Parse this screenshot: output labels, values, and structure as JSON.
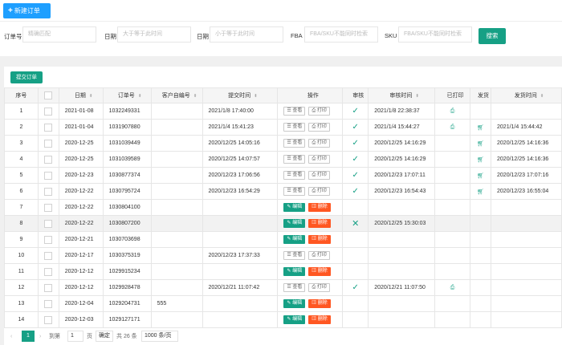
{
  "toolbar": {
    "new_order_label": "新建订单"
  },
  "filters": {
    "order_no_label": "订单号",
    "order_no_placeholder": "精确匹配",
    "date_label_1": "日期",
    "date_from_placeholder": "大于等于此时间",
    "date_label_2": "日期",
    "date_to_placeholder": "小于等于此时间",
    "fba_label": "FBA",
    "fba_placeholder": "FBA/SKU不能同时检索",
    "sku_label": "SKU",
    "sku_placeholder": "FBA/SKU不能同时检索",
    "search_label": "搜索"
  },
  "panel": {
    "submit_label": "提交订单"
  },
  "table": {
    "headers": [
      "序号",
      "",
      "日期",
      "订单号",
      "客户自编号",
      "提交时间",
      "操作",
      "审核",
      "审核时间",
      "已打印",
      "发货",
      "发货时间"
    ],
    "action_labels": {
      "view": "查看",
      "print": "打印",
      "edit": "编辑",
      "delete": "删除"
    },
    "rows": [
      {
        "no": "1",
        "date": "2021-01-08",
        "order": "1032249331",
        "client": "",
        "submit": "2021/1/8 17:40:00",
        "mode": "submitted",
        "audit": "check",
        "audit_time": "2021/1/8 22:38:37",
        "printed": true,
        "shipped": false,
        "ship_time": ""
      },
      {
        "no": "2",
        "date": "2021-01-04",
        "order": "1031907880",
        "client": "",
        "submit": "2021/1/4 15:41:23",
        "mode": "submitted",
        "audit": "check",
        "audit_time": "2021/1/4 15:44:27",
        "printed": true,
        "shipped": true,
        "ship_time": "2021/1/4 15:44:42"
      },
      {
        "no": "3",
        "date": "2020-12-25",
        "order": "1031039449",
        "client": "",
        "submit": "2020/12/25 14:05:16",
        "mode": "submitted",
        "audit": "check",
        "audit_time": "2020/12/25 14:16:29",
        "printed": false,
        "shipped": true,
        "ship_time": "2020/12/25 14:16:36"
      },
      {
        "no": "4",
        "date": "2020-12-25",
        "order": "1031039589",
        "client": "",
        "submit": "2020/12/25 14:07:57",
        "mode": "submitted",
        "audit": "check",
        "audit_time": "2020/12/25 14:16:29",
        "printed": false,
        "shipped": true,
        "ship_time": "2020/12/25 14:16:36"
      },
      {
        "no": "5",
        "date": "2020-12-23",
        "order": "1030877374",
        "client": "",
        "submit": "2020/12/23 17:06:56",
        "mode": "submitted",
        "audit": "check",
        "audit_time": "2020/12/23 17:07:11",
        "printed": false,
        "shipped": true,
        "ship_time": "2020/12/23 17:07:16"
      },
      {
        "no": "6",
        "date": "2020-12-22",
        "order": "1030795724",
        "client": "",
        "submit": "2020/12/23 16:54:29",
        "mode": "submitted",
        "audit": "check",
        "audit_time": "2020/12/23 16:54:43",
        "printed": false,
        "shipped": true,
        "ship_time": "2020/12/23 16:55:04"
      },
      {
        "no": "7",
        "date": "2020-12-22",
        "order": "1030804100",
        "client": "",
        "submit": "",
        "mode": "draft",
        "audit": "",
        "audit_time": "",
        "printed": false,
        "shipped": false,
        "ship_time": ""
      },
      {
        "no": "8",
        "date": "2020-12-22",
        "order": "1030807200",
        "client": "",
        "submit": "",
        "mode": "draft",
        "audit": "cross",
        "audit_time": "2020/12/25 15:30:03",
        "printed": false,
        "shipped": false,
        "ship_time": "",
        "highlight": true
      },
      {
        "no": "9",
        "date": "2020-12-21",
        "order": "1030703698",
        "client": "",
        "submit": "",
        "mode": "draft",
        "audit": "",
        "audit_time": "",
        "printed": false,
        "shipped": false,
        "ship_time": ""
      },
      {
        "no": "10",
        "date": "2020-12-17",
        "order": "1030375319",
        "client": "",
        "submit": "2020/12/23 17:37:33",
        "mode": "submitted",
        "audit": "",
        "audit_time": "",
        "printed": false,
        "shipped": false,
        "ship_time": ""
      },
      {
        "no": "11",
        "date": "2020-12-12",
        "order": "1029915234",
        "client": "",
        "submit": "",
        "mode": "draft",
        "audit": "",
        "audit_time": "",
        "printed": false,
        "shipped": false,
        "ship_time": ""
      },
      {
        "no": "12",
        "date": "2020-12-12",
        "order": "1029928478",
        "client": "",
        "submit": "2020/12/21 11:07:42",
        "mode": "submitted",
        "audit": "check",
        "audit_time": "2020/12/21 11:07:50",
        "printed": true,
        "shipped": false,
        "ship_time": ""
      },
      {
        "no": "13",
        "date": "2020-12-04",
        "order": "1029204731",
        "client": "555",
        "submit": "",
        "mode": "draft",
        "audit": "",
        "audit_time": "",
        "printed": false,
        "shipped": false,
        "ship_time": ""
      },
      {
        "no": "14",
        "date": "2020-12-03",
        "order": "1029127171",
        "client": "",
        "submit": "",
        "mode": "draft",
        "audit": "",
        "audit_time": "",
        "printed": false,
        "shipped": false,
        "ship_time": ""
      }
    ]
  },
  "pager": {
    "current_page": "1",
    "goto_label": "到第",
    "goto_value": "1",
    "page_unit": "页",
    "confirm_label": "确定",
    "total_label": "共 26 条",
    "page_size": "1000 条/页"
  },
  "colors": {
    "primary_blue": "#1e9fff",
    "green": "#16a085",
    "red": "#ff5722"
  }
}
